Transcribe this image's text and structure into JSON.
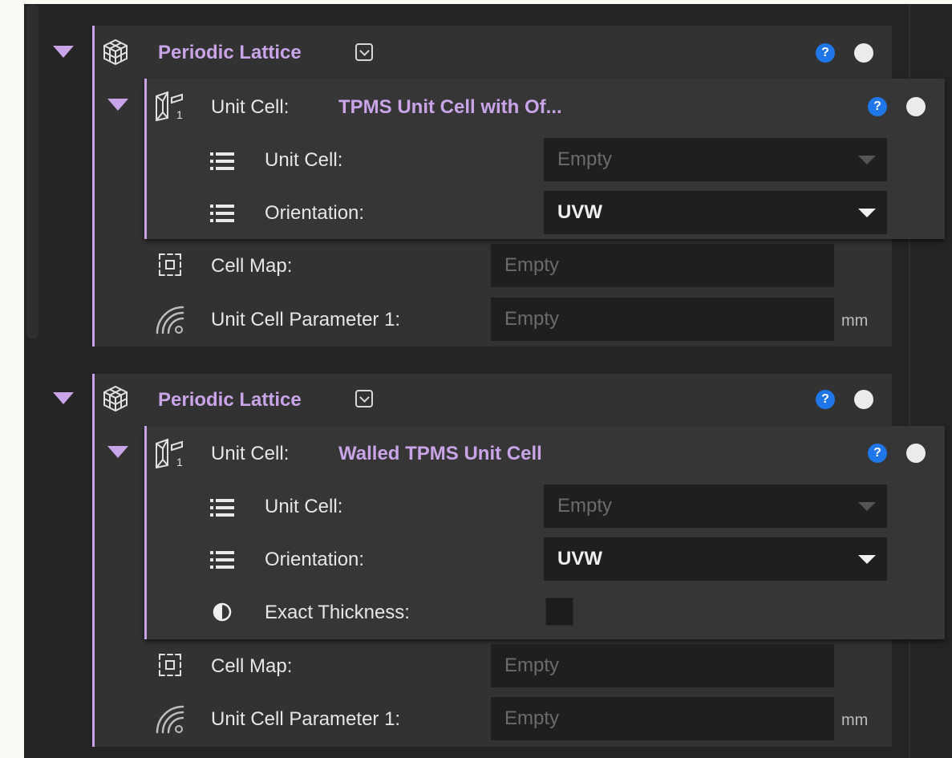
{
  "colors": {
    "accent": "#c9a4e8",
    "help": "#1f76e8",
    "panel": "#242424",
    "field": "#1f1f1f"
  },
  "blocks": [
    {
      "title": "Periodic Lattice",
      "help": "?",
      "unit_cell": {
        "label": "Unit Cell:",
        "title": "TPMS Unit Cell with Of...",
        "help": "?",
        "rows": [
          {
            "icon": "list-icon",
            "label": "Unit Cell:",
            "value": "Empty"
          },
          {
            "icon": "list-icon",
            "label": "Orientation:",
            "value": "UVW"
          }
        ]
      },
      "cell_map": {
        "icon": "cell-map-icon",
        "label": "Cell Map:",
        "value": "Empty"
      },
      "param": {
        "icon": "parameter-icon",
        "label": "Unit Cell Parameter 1:",
        "value": "Empty",
        "unit": "mm"
      }
    },
    {
      "title": "Periodic Lattice",
      "help": "?",
      "unit_cell": {
        "label": "Unit Cell:",
        "title": "Walled TPMS Unit Cell",
        "help": "?",
        "rows": [
          {
            "icon": "list-icon",
            "label": "Unit Cell:",
            "value": "Empty"
          },
          {
            "icon": "list-icon",
            "label": "Orientation:",
            "value": "UVW"
          },
          {
            "icon": "contrast-icon",
            "label": "Exact Thickness:",
            "checked": false
          }
        ]
      },
      "cell_map": {
        "icon": "cell-map-icon",
        "label": "Cell Map:",
        "value": "Empty"
      },
      "param": {
        "icon": "parameter-icon",
        "label": "Unit Cell Parameter 1:",
        "value": "Empty",
        "unit": "mm"
      }
    }
  ]
}
